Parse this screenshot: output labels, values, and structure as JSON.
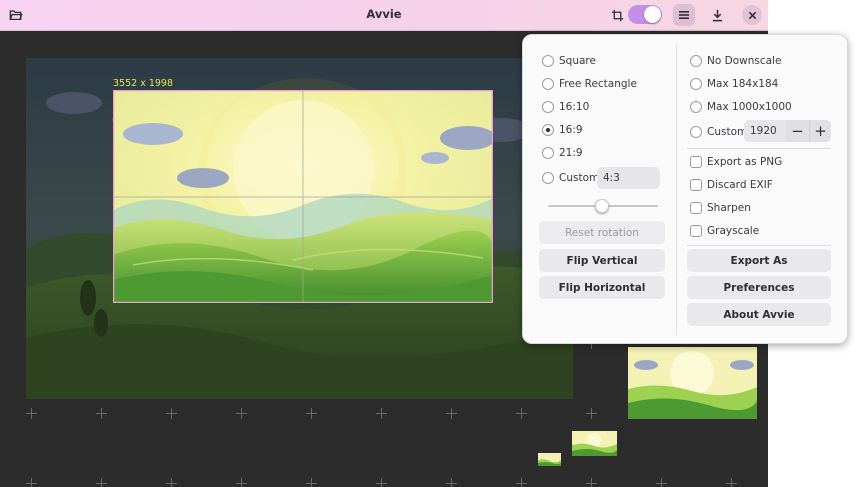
{
  "app": {
    "title": "Avvie"
  },
  "canvas": {
    "dimension_label": "3552 x 1998"
  },
  "popover": {
    "aspect_options": [
      {
        "label": "Square",
        "selected": false
      },
      {
        "label": "Free Rectangle",
        "selected": false
      },
      {
        "label": "16:10",
        "selected": false
      },
      {
        "label": "16:9",
        "selected": true
      },
      {
        "label": "21:9",
        "selected": false
      },
      {
        "label": "Custom",
        "selected": false
      }
    ],
    "custom_ratio_value": "4:3",
    "reset_rotation_label": "Reset rotation",
    "flip_vertical_label": "Flip Vertical",
    "flip_horizontal_label": "Flip Horizontal",
    "downscale_options": [
      {
        "label": "No Downscale",
        "selected": false
      },
      {
        "label": "Max 184x184",
        "selected": false
      },
      {
        "label": "Max 1000x1000",
        "selected": false
      },
      {
        "label": "Custom",
        "selected": false
      }
    ],
    "custom_downscale_value": "1920",
    "stepper_minus": "−",
    "stepper_plus": "+",
    "checkboxes": [
      {
        "label": "Export as PNG",
        "checked": false
      },
      {
        "label": "Discard EXIF",
        "checked": false
      },
      {
        "label": "Sharpen",
        "checked": false
      },
      {
        "label": "Grayscale",
        "checked": false
      }
    ],
    "export_as_label": "Export As",
    "preferences_label": "Preferences",
    "about_label": "About Avvie"
  },
  "colors": {
    "accent": "#c58fe8",
    "crop_border": "#f29ad5",
    "dim_label": "#e8e45a"
  }
}
